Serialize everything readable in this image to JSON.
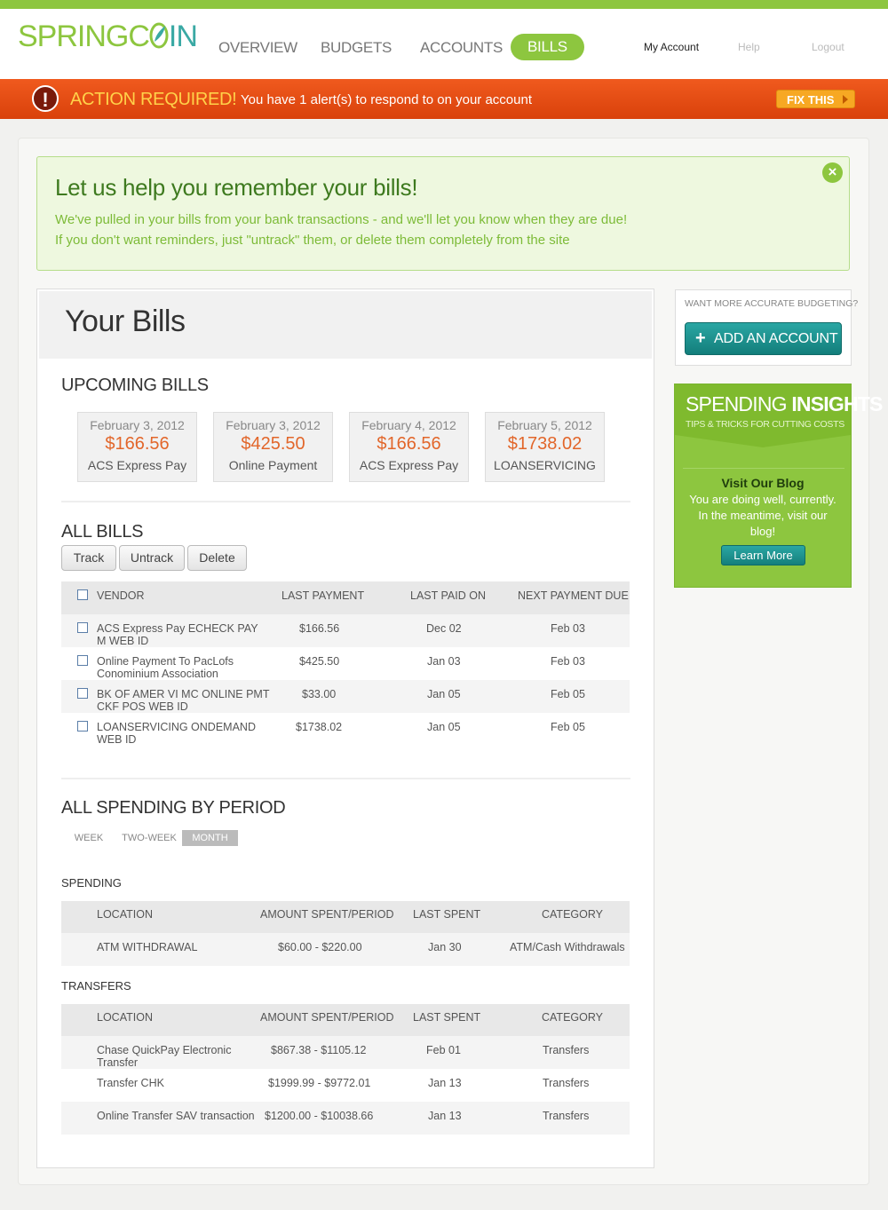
{
  "header": {
    "logo_prefix": "SPRINGC",
    "logo_suffix": "IN",
    "nav": [
      "OVERVIEW",
      "BUDGETS",
      "ACCOUNTS",
      "BILLS"
    ],
    "active_nav": "BILLS",
    "util": {
      "my_account": "My Account",
      "help": "Help",
      "logout": "Logout"
    }
  },
  "alert": {
    "icon": "!",
    "title": "ACTION REQUIRED!",
    "message": "You have 1 alert(s) to respond to on your account",
    "fix_label": "FIX THIS"
  },
  "info": {
    "title": "Let us help you remember your bills!",
    "line1": "We've pulled in your bills from your bank transactions - and we'll let you know when they are due!",
    "line2": "If you don't want reminders, just \"untrack\" them, or delete them completely from the site"
  },
  "bills": {
    "title": "Your Bills",
    "upcoming_title": "UPCOMING BILLS",
    "upcoming": [
      {
        "date": "February 3, 2012",
        "amount": "$166.56",
        "vendor": "ACS Express Pay"
      },
      {
        "date": "February 3, 2012",
        "amount": "$425.50",
        "vendor": "Online Payment"
      },
      {
        "date": "February 4, 2012",
        "amount": "$166.56",
        "vendor": "ACS Express Pay"
      },
      {
        "date": "February 5, 2012",
        "amount": "$1738.02",
        "vendor": "LOANSERVICING"
      }
    ],
    "all_title": "ALL BILLS",
    "buttons": {
      "track": "Track",
      "untrack": "Untrack",
      "delete": "Delete"
    },
    "columns": {
      "vendor": "VENDOR",
      "last_payment": "LAST PAYMENT",
      "last_paid_on": "LAST PAID ON",
      "next_due": "NEXT PAYMENT DUE"
    },
    "rows": [
      {
        "vendor1": "ACS Express Pay ECHECK PAY",
        "vendor2": "M WEB ID",
        "last_payment": "$166.56",
        "last_paid_on": "Dec 02",
        "next_due": "Feb 03"
      },
      {
        "vendor1": "Online Payment To PacLofs",
        "vendor2": "Conominium Association",
        "last_payment": "$425.50",
        "last_paid_on": "Jan 03",
        "next_due": "Feb 03"
      },
      {
        "vendor1": "BK OF AMER VI MC ONLINE PMT",
        "vendor2": "CKF POS WEB ID",
        "last_payment": "$33.00",
        "last_paid_on": "Jan 05",
        "next_due": "Feb 05"
      },
      {
        "vendor1": "LOANSERVICING ONDEMAND",
        "vendor2": "WEB ID",
        "last_payment": "$1738.02",
        "last_paid_on": "Jan 05",
        "next_due": "Feb 05"
      }
    ]
  },
  "spending": {
    "title": "ALL SPENDING BY PERIOD",
    "periods": [
      "WEEK",
      "TWO-WEEK",
      "MONTH"
    ],
    "active_period": "MONTH",
    "spending_label": "SPENDING",
    "transfers_label": "TRANSFERS",
    "columns": {
      "location": "LOCATION",
      "amount": "AMOUNT SPENT/PERIOD",
      "last_spent": "LAST SPENT",
      "category": "CATEGORY"
    },
    "spending_rows": [
      {
        "location1": "ATM WITHDRAWAL",
        "location2": "",
        "amount": "$60.00 - $220.00",
        "last_spent": "Jan 30",
        "category": "ATM/Cash Withdrawals"
      }
    ],
    "transfer_rows": [
      {
        "location1": "Chase QuickPay Electronic",
        "location2": "Transfer",
        "amount": "$867.38 - $1105.12",
        "last_spent": "Feb 01",
        "category": "Transfers"
      },
      {
        "location1": "Transfer CHK",
        "location2": "",
        "amount": "$1999.99 - $9772.01",
        "last_spent": "Jan 13",
        "category": "Transfers"
      },
      {
        "location1": "Online Transfer SAV transaction",
        "location2": "",
        "amount": "$1200.00 - $10038.66",
        "last_spent": "Jan 13",
        "category": "Transfers"
      }
    ]
  },
  "sidebar": {
    "prompt": "WANT MORE ACCURATE BUDGETING?",
    "add_account": "ADD AN ACCOUNT",
    "insights_title_light": "SPENDING ",
    "insights_title_bold": "INSIGHTS",
    "insights_sub": "TIPS & TRICKS FOR CUTTING COSTS",
    "blog_title": "Visit Our Blog",
    "blog_text": "You are doing well, currently. In the meantime, visit our blog!",
    "learn_more": "Learn More"
  },
  "colors": {
    "brand_green": "#8dc63f",
    "teal": "#1e9491",
    "alert_orange": "#e84d12",
    "amount_orange": "#e2662a"
  }
}
